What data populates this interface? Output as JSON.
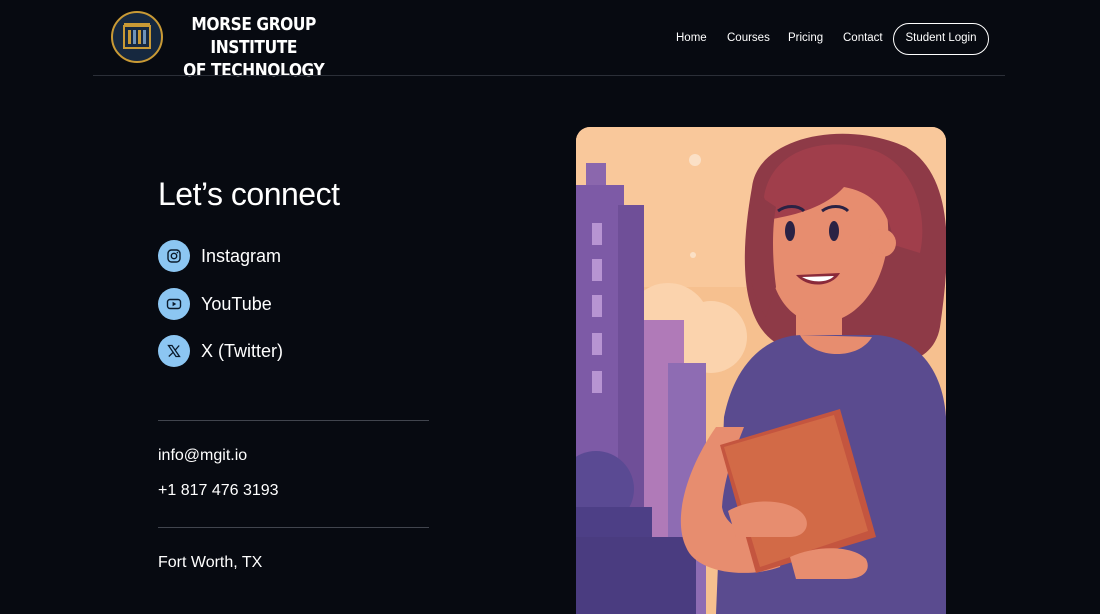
{
  "header": {
    "brand_line1": "MORSE GROUP INSTITUTE",
    "brand_line2": "OF TECHNOLOGY",
    "nav": [
      "Home",
      "Courses",
      "Pricing",
      "Contact"
    ],
    "login_label": "Student Login"
  },
  "main": {
    "heading": "Let’s connect",
    "socials": [
      {
        "label": "Instagram",
        "icon": "instagram-icon"
      },
      {
        "label": "YouTube",
        "icon": "youtube-icon"
      },
      {
        "label": "X (Twitter)",
        "icon": "x-twitter-icon"
      }
    ],
    "email": "info@mgit.io",
    "phone": "+1 817 476 3193",
    "location": "Fort Worth, TX"
  },
  "colors": {
    "background": "#070a11",
    "icon_circle": "#8cc6f2",
    "logo_ring": "#c99a35",
    "illustration_sky": "#f6c08f"
  }
}
